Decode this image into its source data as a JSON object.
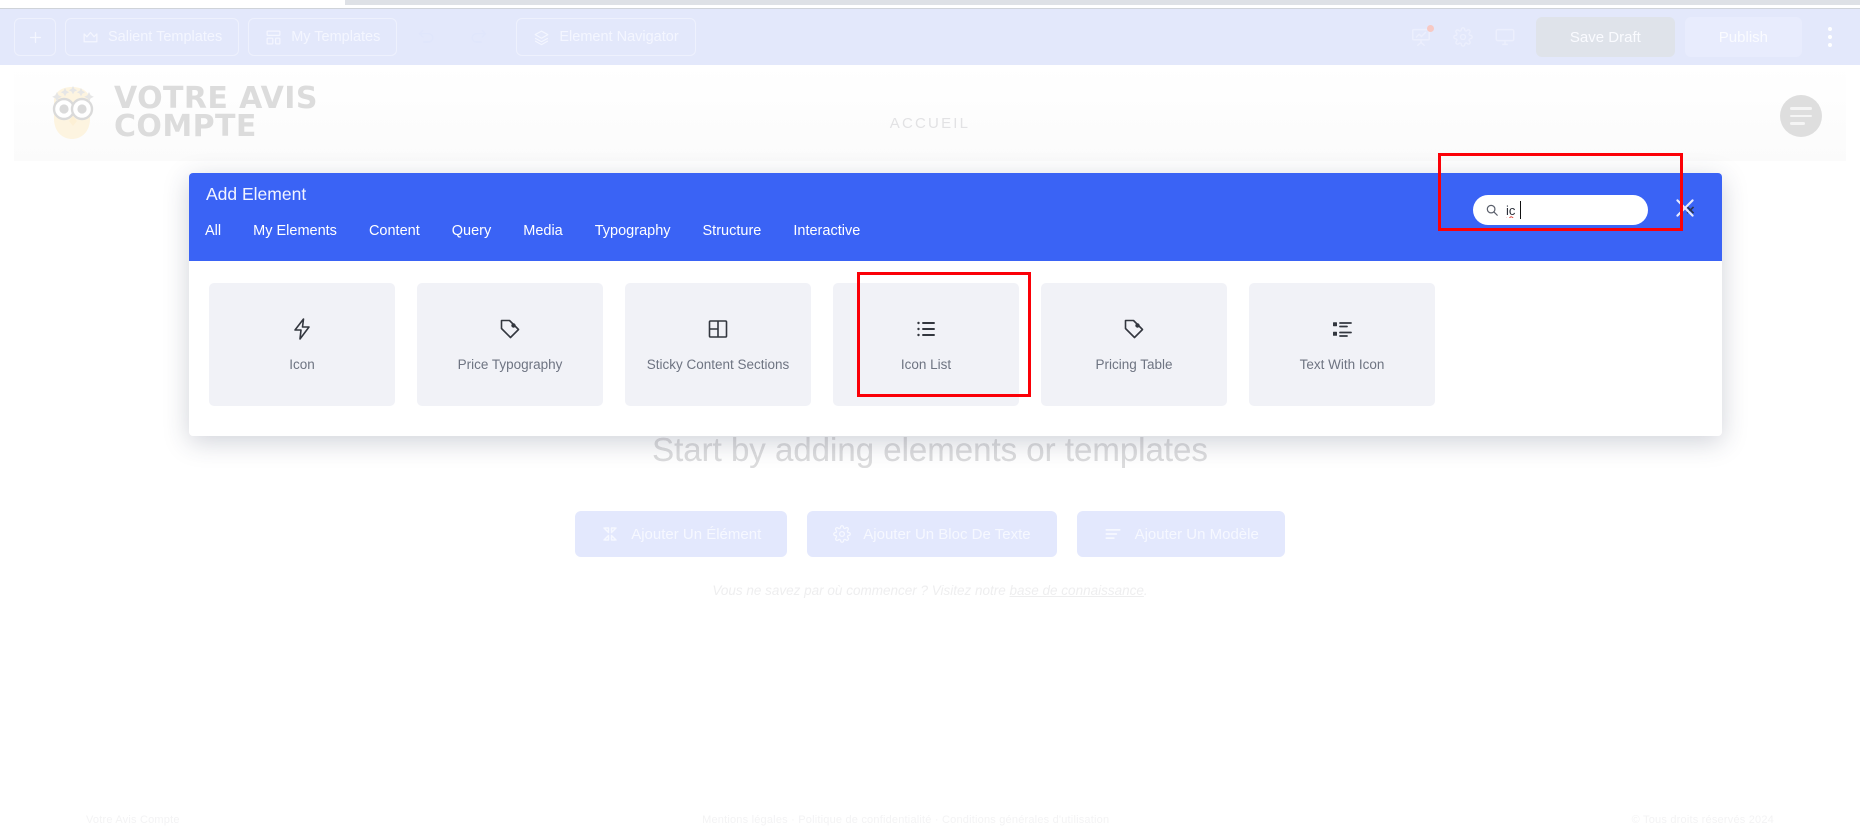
{
  "editor_toolbar": {
    "left_buttons": [
      {
        "id": "add",
        "label": "",
        "icon": "plus-icon"
      },
      {
        "id": "salient-templates",
        "label": "Salient Templates",
        "icon": "crown-icon"
      },
      {
        "id": "my-templates",
        "label": "My Templates",
        "icon": "layout-icon"
      }
    ],
    "history_buttons": [
      {
        "id": "undo",
        "icon": "undo-icon"
      },
      {
        "id": "redo",
        "icon": "redo-icon"
      }
    ],
    "navigator_button": {
      "label": "Element Navigator",
      "icon": "layers-icon"
    },
    "right_icons": [
      {
        "id": "analytics",
        "icon": "presentation-chart-icon",
        "badge": true
      },
      {
        "id": "settings",
        "icon": "gear-icon",
        "badge": false
      },
      {
        "id": "responsive",
        "icon": "monitor-icon",
        "badge": false
      }
    ],
    "save_draft_label": "Save Draft",
    "publish_label": "Publish",
    "kebab_icon": "kebab-menu-icon"
  },
  "site_preview": {
    "logo_text_line1": "Votre Avis",
    "logo_text_line2": "Compte",
    "logo_icon": "owl-icon",
    "nav_items": [
      "ACCUEIL"
    ],
    "hamburger_icon": "hamburger-menu-icon",
    "empty_state": {
      "title": "Start by adding elements or templates",
      "buttons": [
        {
          "label": "Ajouter Un Élément",
          "icon": "collapse-arrows-icon"
        },
        {
          "label": "Ajouter Un Bloc De Texte",
          "icon": "gear-icon"
        },
        {
          "label": "Ajouter Un Modèle",
          "icon": "lines-icon"
        }
      ],
      "hint_prefix": "Vous ne savez par où commencer ? Visitez notre ",
      "hint_link": "base de connaissance",
      "hint_suffix": "."
    },
    "footer_left": "Votre Avis Compte",
    "footer_center": "Mentions légales · Politique de confidentialité · Conditions générales d'utilisation",
    "footer_right": "© Tous droits réservés 2024"
  },
  "add_element_modal": {
    "title": "Add Element",
    "tabs": [
      {
        "id": "all",
        "label": "All",
        "active": true
      },
      {
        "id": "my-elements",
        "label": "My Elements",
        "active": false
      },
      {
        "id": "content",
        "label": "Content",
        "active": false
      },
      {
        "id": "query",
        "label": "Query",
        "active": false
      },
      {
        "id": "media",
        "label": "Media",
        "active": false
      },
      {
        "id": "typography",
        "label": "Typography",
        "active": false
      },
      {
        "id": "structure",
        "label": "Structure",
        "active": false
      },
      {
        "id": "interactive",
        "label": "Interactive",
        "active": false
      }
    ],
    "search": {
      "value": "ic",
      "placeholder": "",
      "icon": "search-icon",
      "clear_icon": "clear-x-icon"
    },
    "close_icon": "close-x-icon",
    "elements": [
      {
        "id": "icon",
        "label": "Icon",
        "icon": "lightning-bolt-icon",
        "selected": false
      },
      {
        "id": "price-typography",
        "label": "Price Typography",
        "icon": "price-tag-icon",
        "selected": false
      },
      {
        "id": "sticky-content-sections",
        "label": "Sticky Content Sections",
        "icon": "split-panel-icon",
        "selected": false
      },
      {
        "id": "icon-list",
        "label": "Icon List",
        "icon": "bullet-list-icon",
        "selected": true
      },
      {
        "id": "pricing-table",
        "label": "Pricing Table",
        "icon": "price-tag-icon",
        "selected": false
      },
      {
        "id": "text-with-icon",
        "label": "Text With Icon",
        "icon": "text-with-icon-icon",
        "selected": false
      }
    ]
  },
  "annotations": {
    "highlight_color": "#fb0007",
    "search_box_highlighted": true,
    "icon_list_card_highlighted": true
  },
  "theme": {
    "toolbar_bg": "#e3e8fb",
    "modal_header_bg": "#3a63f5",
    "card_bg": "#f1f2f7",
    "accent": "#3a63f5"
  }
}
